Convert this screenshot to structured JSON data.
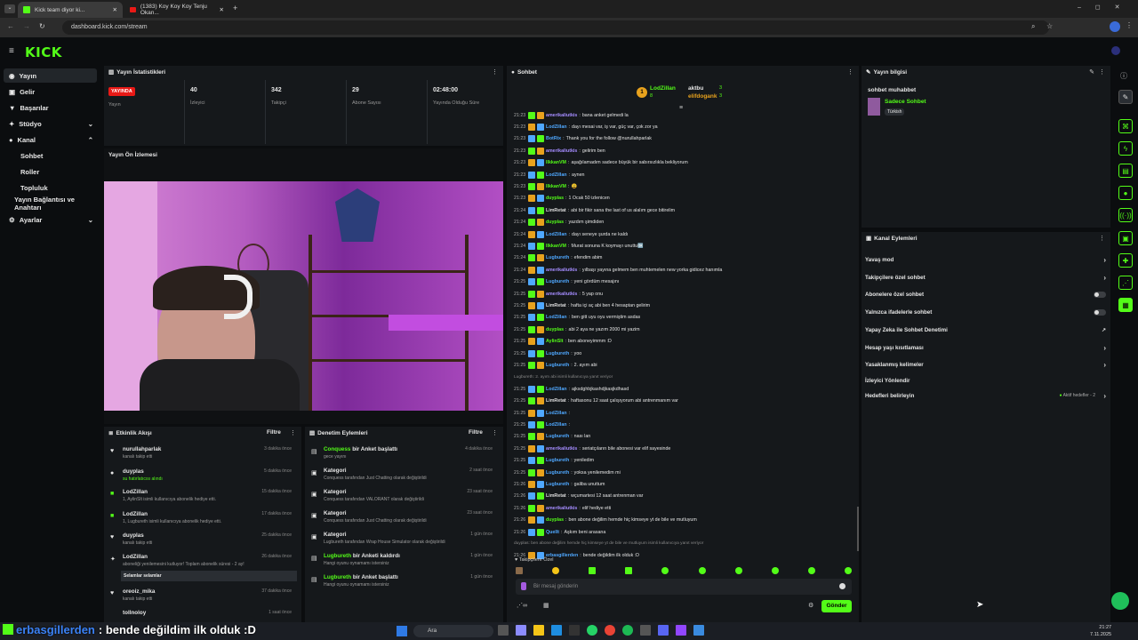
{
  "browser": {
    "tabs": [
      {
        "title": "Kick team diyor ki..."
      },
      {
        "title": "(1383) Koy Koy Koy Tenju Okan..."
      }
    ],
    "url": "dashboard.kick.com/stream"
  },
  "brand": {
    "logo": "KICK",
    "accent": "#53fc18"
  },
  "sidebar": {
    "items": [
      {
        "label": "Yayın",
        "icon": "broadcast-icon"
      },
      {
        "label": "Gelir",
        "icon": "wallet-icon"
      },
      {
        "label": "Başarılar",
        "icon": "trophy-icon"
      },
      {
        "label": "Stüdyo",
        "icon": "studio-icon"
      },
      {
        "label": "Kanal",
        "icon": "channel-icon"
      },
      {
        "label": "Sohbet"
      },
      {
        "label": "Roller"
      },
      {
        "label": "Topluluk"
      },
      {
        "label": "Yayın Bağlantısı ve Anahtarı"
      },
      {
        "label": "Ayarlar",
        "icon": "gear-icon"
      }
    ]
  },
  "stats": {
    "title": "Yayın İstatistikleri",
    "live_badge": "YAYINDA",
    "stream_label": "Yayın",
    "items": [
      {
        "value": "40",
        "label": "İzleyici"
      },
      {
        "value": "342",
        "label": "Takipçi"
      },
      {
        "value": "29",
        "label": "Abone Sayısı"
      },
      {
        "value": "02:48:00",
        "label": "Yayında Olduğu Süre"
      }
    ]
  },
  "preview": {
    "title": "Yayın Ön İzlemesi"
  },
  "activity": {
    "title": "Etkinlik Akışı",
    "filter": "Filtre",
    "items": [
      {
        "name": "nurullahparlak",
        "sub": "kanalı takip etti",
        "time": "3 dakika önce"
      },
      {
        "name": "duyplas",
        "sub": "su hatırlatıcısı alındı",
        "time": "5 dakika önce"
      },
      {
        "name": "LodZillan",
        "sub": "1, AylinSlt isimli kullanıcıya abonelik hediye etti.",
        "time": "15 dakika önce"
      },
      {
        "name": "LodZillan",
        "sub": "1, Lugbureth isimli kullanıcıya abonelik hediye etti.",
        "time": "17 dakika önce"
      },
      {
        "name": "duyplas",
        "sub": "kanalı takip etti",
        "time": "25 dakika önce"
      },
      {
        "name": "LodZillan",
        "sub": "aboneliği yenilemesini kutluyor! Toplam abonelik süresi - 2 ay!",
        "time": "26 dakika önce",
        "note": "Selamlar selamlar"
      },
      {
        "name": "oreoiz_mika",
        "sub": "kanalı takip etti",
        "time": "37 dakika önce"
      },
      {
        "name": "tollnoloy",
        "sub": "",
        "time": "1 saat önce"
      }
    ]
  },
  "moderation": {
    "title": "Denetim Eylemleri",
    "filter": "Filtre",
    "items": [
      {
        "name": "Conquess",
        "action": "bir Anket başlattı",
        "sub": "gece yayını",
        "time": "4 dakika önce"
      },
      {
        "name": "Kategori",
        "action": "",
        "sub": "Conquess tarafından Just Chatting olarak değiştirildi",
        "time": "2 saat önce"
      },
      {
        "name": "Kategori",
        "action": "",
        "sub": "Conquess tarafından VALORANT olarak değiştirildi",
        "time": "23 saat önce"
      },
      {
        "name": "Kategori",
        "action": "",
        "sub": "Conquess tarafından Just Chatting olarak değiştirildi",
        "time": "23 saat önce"
      },
      {
        "name": "Kategori",
        "action": "",
        "sub": "Lugbureth tarafından Wrap House Simulator olarak değiştirildi",
        "time": "1 gün önce"
      },
      {
        "name": "Lugbureth",
        "action": "bir Anketi kaldırdı",
        "sub": "Hangi oyunu oynamamı istersiniz",
        "time": "1 gün önce"
      },
      {
        "name": "Lugbureth",
        "action": "bir Anket başlattı",
        "sub": "Hangi oyunu oynamamı istersiniz",
        "time": "1 gün önce"
      }
    ]
  },
  "chat": {
    "title": "Sohbet",
    "top": [
      {
        "name": "LodZillan",
        "count": "8"
      },
      {
        "name": "aktbu",
        "count": "3"
      },
      {
        "name": "elifdogank",
        "count": "3"
      }
    ],
    "messages": [
      {
        "t": "21:23",
        "u": "amerikaliutkis",
        "c": "#a58cff",
        "m": "bana anket gelmedi la"
      },
      {
        "t": "21:23",
        "u": "LodZillan",
        "c": "#4fa8ff",
        "m": "dayı mesai var, iş var, güç var, çok zor ya"
      },
      {
        "t": "21:23",
        "u": "BotRix",
        "c": "#4fa8ff",
        "m": "Thank you for the follow @nurullahparlak"
      },
      {
        "t": "21:23",
        "u": "amerikaliutkis",
        "c": "#a58cff",
        "m": "gelirim ben"
      },
      {
        "t": "21:23",
        "u": "IlkkanVM",
        "c": "#53fc18",
        "m": "aşağılamadım sadece büyük bir sabırsızlıkla bekliyorum"
      },
      {
        "t": "21:23",
        "u": "LodZillan",
        "c": "#4fa8ff",
        "m": "aynen"
      },
      {
        "t": "21:23",
        "u": "IlkkanVM",
        "c": "#53fc18",
        "m": "😩"
      },
      {
        "t": "21:23",
        "u": "duyplas",
        "c": "#53fc18",
        "m": "1 Ocak 50 izlenicen"
      },
      {
        "t": "21:24",
        "u": "LimRetat",
        "c": "#dddddd",
        "m": "abi bir fikir sana the last of us alalım gece bitirelim"
      },
      {
        "t": "21:24",
        "u": "duyplas",
        "c": "#53fc18",
        "m": "yazdım şimdiden"
      },
      {
        "t": "21:24",
        "u": "LodZillan",
        "c": "#4fa8ff",
        "m": "dayı seneye şurda ne kaldı"
      },
      {
        "t": "21:24",
        "u": "IlkkanVM",
        "c": "#53fc18",
        "m": "Murat sonuna K koymayı unuttu🆗"
      },
      {
        "t": "21:24",
        "u": "Lugbureth",
        "c": "#4fa8ff",
        "m": "efendim abim"
      },
      {
        "t": "21:24",
        "u": "amerikaliutkis",
        "c": "#a58cff",
        "m": "yılbaşı yayına gelmem ben muhtemelen new yorka gidicez hanımla"
      },
      {
        "t": "21:25",
        "u": "Lugbureth",
        "c": "#4fa8ff",
        "m": "yeni gördüm mesajını"
      },
      {
        "t": "21:25",
        "u": "amerikaliutkis",
        "c": "#a58cff",
        "m": "5 yap onu"
      },
      {
        "t": "21:25",
        "u": "LimRetat",
        "c": "#dddddd",
        "m": "hafta içi aç abi ben 4 hesaptan gelirim"
      },
      {
        "t": "21:25",
        "u": "LodZillan",
        "c": "#4fa8ff",
        "m": "ben gitt uyu oyu vermiştim asdas"
      },
      {
        "t": "21:25",
        "u": "duyplas",
        "c": "#53fc18",
        "m": "abi 2 aya ne yazım 2000 mi yazim"
      },
      {
        "t": "21:25",
        "u": "AylinSlt",
        "c": "#53fc18",
        "m": "ben aboneyimmm :D"
      },
      {
        "t": "21:25",
        "u": "Lugbureth",
        "c": "#4fa8ff",
        "m": "yoo"
      },
      {
        "t": "21:25",
        "u": "Lugbureth",
        "c": "#4fa8ff",
        "m": "2. ayım abi"
      },
      {
        "t": "",
        "u": "",
        "c": "#888888",
        "m": "Lugbureth: 2. ayım abi isimli kullanıcıya yanıt veriyor"
      },
      {
        "t": "21:25",
        "u": "LodZillan",
        "c": "#4fa8ff",
        "m": "ajksdghbjkashdjkasjkdhasd"
      },
      {
        "t": "21:25",
        "u": "LimRetat",
        "c": "#dddddd",
        "m": "haftasonu 12 saat çalışıyorum abi antrenmanım var"
      },
      {
        "t": "21:25",
        "u": "LodZillan",
        "c": "#4fa8ff",
        "m": ""
      },
      {
        "t": "21:25",
        "u": "LodZillan",
        "c": "#4fa8ff",
        "m": ""
      },
      {
        "t": "21:25",
        "u": "Lugbureth",
        "c": "#4fa8ff",
        "m": "nası lan"
      },
      {
        "t": "21:25",
        "u": "amerikaliutkis",
        "c": "#a58cff",
        "m": "seriatçıların bile abonesi var elif sayesinde"
      },
      {
        "t": "21:25",
        "u": "Lugbureth",
        "c": "#4fa8ff",
        "m": "yeniledim"
      },
      {
        "t": "21:25",
        "u": "Lugbureth",
        "c": "#4fa8ff",
        "m": "yoksa yenilemedim mi"
      },
      {
        "t": "21:26",
        "u": "Lugbureth",
        "c": "#4fa8ff",
        "m": "galiba unuttum"
      },
      {
        "t": "21:26",
        "u": "LimRetat",
        "c": "#dddddd",
        "m": "wçumartesi 12 saat antrenman var"
      },
      {
        "t": "21:26",
        "u": "amerikaliutkis",
        "c": "#a58cff",
        "m": "elif hediye etti"
      },
      {
        "t": "21:26",
        "u": "duyplas",
        "c": "#53fc18",
        "m": "ben abone değilim hemde hiç kimseye yt de bile ve mutluyum"
      },
      {
        "t": "21:26",
        "u": "QuelIt",
        "c": "#4fa8ff",
        "m": "Aşkım beni arasana"
      },
      {
        "t": "",
        "u": "",
        "c": "#888888",
        "m": "duyplas: ben abone değilim hemde hiç kimseye yt de bile ve mutluyum isimli kullanıcıya yanıt veriyor"
      },
      {
        "t": "21:26",
        "u": "erbasgillerden",
        "c": "#4fa8ff",
        "m": "bende değildim ilk olduk :D"
      }
    ],
    "followers_only": "Takipçilere Özel",
    "input_placeholder": "Bir mesaj gönderin",
    "send": "Gönder"
  },
  "stream_info": {
    "title": "Yayın bilgisi",
    "stream_title": "sohbet muhabbet",
    "category": "Sadece Sohbet",
    "language": "Türkish"
  },
  "channel_actions": {
    "title": "Kanal Eylemleri",
    "items": [
      {
        "label": "Yavaş mod",
        "type": "chevron"
      },
      {
        "label": "Takipçilere özel sohbet",
        "type": "chevron"
      },
      {
        "label": "Abonelere özel sohbet",
        "type": "toggle"
      },
      {
        "label": "Yalnızca ifadelerle sohbet",
        "type": "toggle"
      },
      {
        "label": "Yapay Zeka ile Sohbet Denetimi",
        "type": "link"
      },
      {
        "label": "Hesap yaşı kısıtlaması",
        "type": "chevron"
      },
      {
        "label": "Yasaklanmış kelimeler",
        "type": "chevron"
      },
      {
        "label": "İzleyici Yönlendir",
        "type": "none"
      },
      {
        "label": "Hedefleri belirleyin",
        "type": "chevron",
        "extra": "Aktif hedefler - 2"
      }
    ]
  },
  "overlay_caption": {
    "user": "erbasgillerden",
    "text": ": bende değildim ilk olduk :D"
  },
  "taskbar": {
    "search": "Ara",
    "time": "21:27",
    "date": "7.11.2025"
  }
}
